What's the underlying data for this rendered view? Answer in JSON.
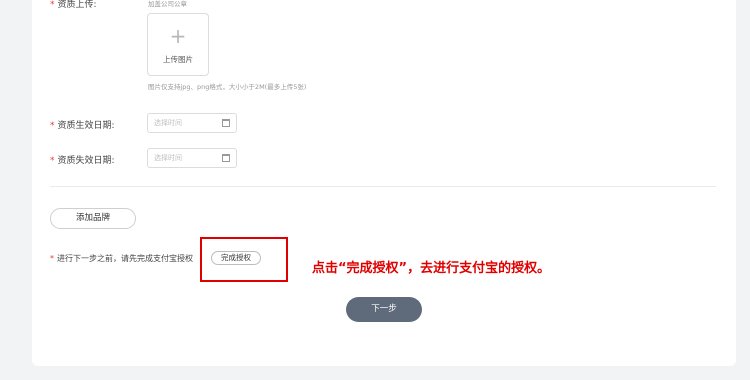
{
  "form": {
    "qualification_upload": {
      "label": "资质上传:",
      "top_hint": "加盖公司公章",
      "upload_button_label": "上传图片",
      "format_hint": "图片仅支持jpg、png格式，大小小于2M(最多上传5张)"
    },
    "effective_date": {
      "label": "资质生效日期:",
      "placeholder": "选择时间"
    },
    "expiry_date": {
      "label": "资质失效日期:",
      "placeholder": "选择时间"
    },
    "required_mark": "*"
  },
  "add_brand_label": "添加品牌",
  "authorization": {
    "notice": "进行下一步之前，请先完成支付宝授权",
    "button_label": "完成授权"
  },
  "annotation_text": "点击“完成授权”，去进行支付宝的授权。",
  "next_button_label": "下一步",
  "icons": {
    "upload": "plus-icon",
    "calendar": "calendar-icon"
  },
  "colors": {
    "required": "#e23b3b",
    "annotation": "#e00000",
    "next_button": "#5f6b7a"
  }
}
